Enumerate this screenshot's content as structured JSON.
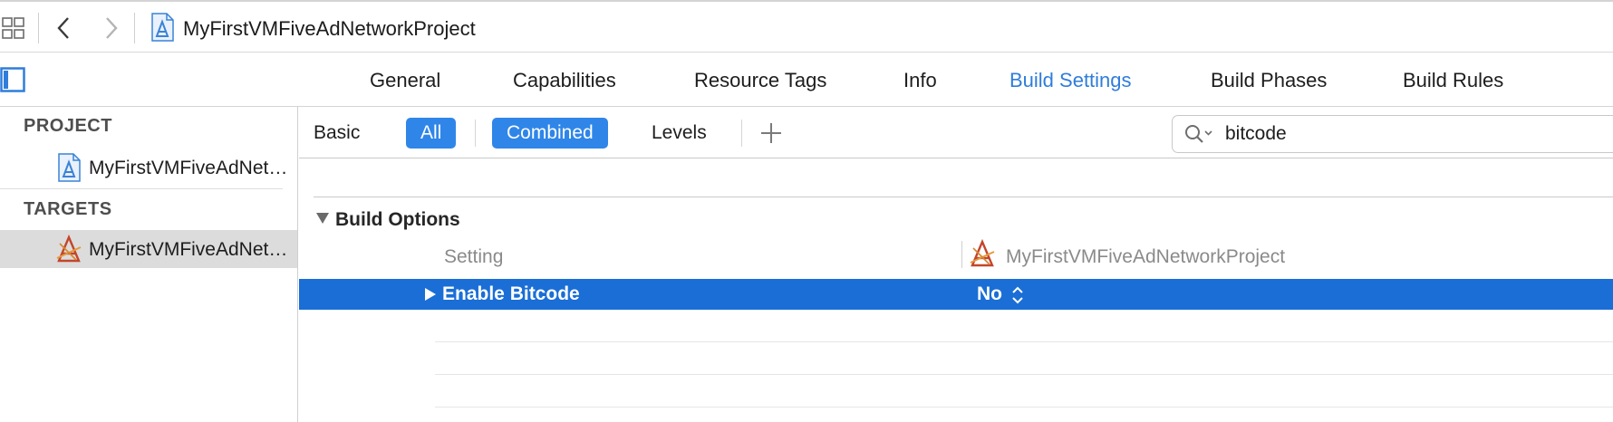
{
  "jumpbar": {
    "grid_icon": "related-items-grid-icon",
    "back_icon": "chevron-left-icon",
    "forward_icon": "chevron-right-icon",
    "project_icon": "xcode-project-icon",
    "title": "MyFirstVMFiveAdNetworkProject"
  },
  "tabbar": {
    "sidebar_toggle_icon": "sidebar-toggle-icon",
    "tabs": [
      {
        "label": "General"
      },
      {
        "label": "Capabilities"
      },
      {
        "label": "Resource Tags"
      },
      {
        "label": "Info"
      },
      {
        "label": "Build Settings",
        "active": true
      },
      {
        "label": "Build Phases"
      },
      {
        "label": "Build Rules"
      }
    ]
  },
  "sidebar": {
    "project_header": "PROJECT",
    "project_item": "MyFirstVMFiveAdNetworkProject",
    "targets_header": "TARGETS",
    "target_item": "MyFirstVMFiveAdNetworkProject"
  },
  "filterbar": {
    "basic": "Basic",
    "all": "All",
    "combined": "Combined",
    "levels": "Levels",
    "add_icon": "plus-icon",
    "search_value": "bitcode",
    "search_icon": "search-icon"
  },
  "content": {
    "section_title": "Build Options",
    "col_setting": "Setting",
    "col_target": "MyFirstVMFiveAdNetworkProject",
    "rows": [
      {
        "name": "Enable Bitcode",
        "value": "No"
      }
    ]
  },
  "colors": {
    "accent": "#2f7ddb",
    "selection": "#1a6ed6",
    "segment_on": "#2f86e8"
  }
}
